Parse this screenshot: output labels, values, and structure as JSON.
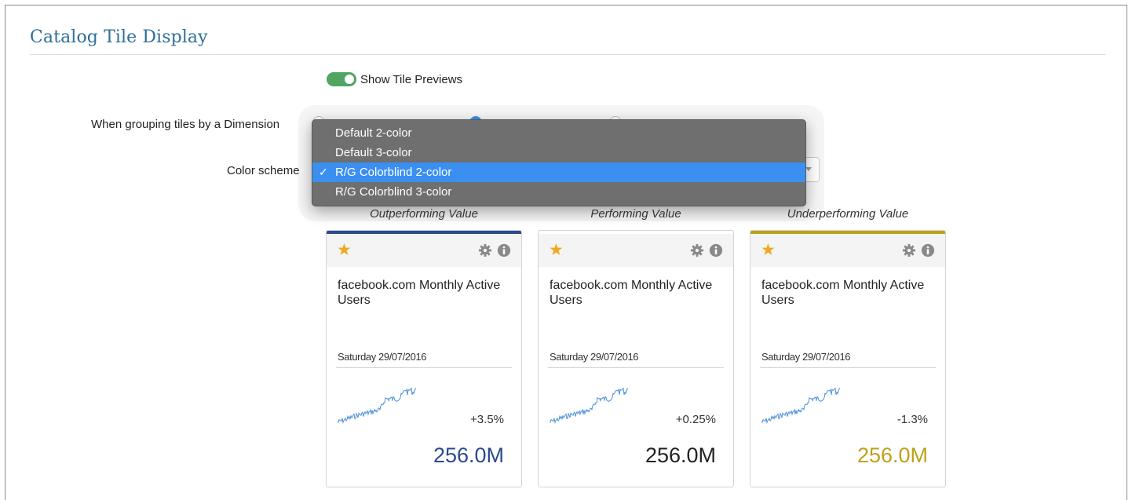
{
  "section": {
    "title": "Catalog Tile Display"
  },
  "toggle": {
    "label": "Show Tile Previews",
    "on": true
  },
  "grouping": {
    "label": "When grouping tiles by a Dimension"
  },
  "color_scheme": {
    "label": "Color scheme",
    "options": [
      {
        "label": "Default 2-color",
        "selected": false
      },
      {
        "label": "Default 3-color",
        "selected": false
      },
      {
        "label": "R/G Colorblind 2-color",
        "selected": true
      },
      {
        "label": "R/G Colorblind 3-color",
        "selected": false
      }
    ],
    "check_glyph": "✓"
  },
  "columns": [
    {
      "caption": "Outperforming Value"
    },
    {
      "caption": "Performing Value"
    },
    {
      "caption": "Underperforming Value"
    }
  ],
  "tiles": [
    {
      "title": "facebook.com Monthly Active Users",
      "date": "Saturday 29/07/2016",
      "change": "+3.5%",
      "value": "256.0M",
      "accent_color": "#2b4a8c",
      "value_color": "#2b4a8c"
    },
    {
      "title": "facebook.com Monthly Active Users",
      "date": "Saturday 29/07/2016",
      "change": "+0.25%",
      "value": "256.0M",
      "accent_color": null,
      "value_color": "#222222"
    },
    {
      "title": "facebook.com Monthly Active Users",
      "date": "Saturday 29/07/2016",
      "change": "-1.3%",
      "value": "256.0M",
      "accent_color": "#bda21a",
      "value_color": "#bda21a"
    }
  ],
  "icons": {
    "favorite": "star-icon",
    "settings": "gear-icon",
    "info": "info-icon"
  },
  "colors": {
    "title": "#2f6f9a",
    "toggle_on": "#4fa561",
    "menu_bg": "#6f6f6f",
    "menu_selected": "#3b8ff0",
    "star": "#f0a820",
    "sparkline": "#4a90d9"
  }
}
